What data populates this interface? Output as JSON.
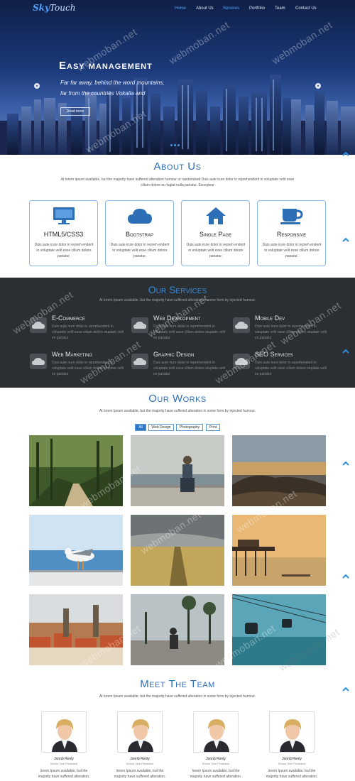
{
  "brand": {
    "part1": "Sky",
    "part2": "Touch"
  },
  "nav": [
    {
      "label": "Home",
      "active": true
    },
    {
      "label": "About Us",
      "active": false
    },
    {
      "label": "Services",
      "active": true
    },
    {
      "label": "Portfolio",
      "active": false
    },
    {
      "label": "Team",
      "active": false
    },
    {
      "label": "Contact Us",
      "active": false
    }
  ],
  "hero": {
    "title": "Easy management",
    "sub_line1": "Far far away, behind the word mountains,",
    "sub_line2": "far from the countries Vokalia and",
    "button": "Read more"
  },
  "about": {
    "title": "About Us",
    "text_line1": "At lorem ipsum available, but the majority have suffered alteration humour or randomised Duis aute irure dolor in reprehenderit in voluptate velit esse",
    "text_line2": "cillum dolore eu fugiat nulla pariatur. Excepteur",
    "cards": [
      {
        "icon": "monitor-icon",
        "name": "HTML5/CSS3",
        "desc": "Duis aute irure dolor in repreh enderit in voluptate velit esse cillum dolore pariatur."
      },
      {
        "icon": "cloud-icon",
        "name": "Bootstrap",
        "desc": "Duis aute irure dolor in repreh enderit in voluptate velit esse cillum dolore pariatur."
      },
      {
        "icon": "home-icon",
        "name": "Single Page",
        "desc": "Duis aute irure dolor in repreh enderit in voluptate velit esse cillum dolore pariatur."
      },
      {
        "icon": "coffee-cup-icon",
        "name": "Responsive",
        "desc": "Duis aute irure dolor in repreh enderit in voluptate velit esse cillum dolore pariatur."
      }
    ]
  },
  "services": {
    "title": "Our Services",
    "text": "At lorem Ipsum available, but the majority have suffered alteration in some form by injected humour.",
    "items": [
      {
        "name": "E-Commerce",
        "desc": "Duis aute irure dolor in reprehenderit in voluptate velit esse cillum dolore stuplate velit es pariatur"
      },
      {
        "name": "Web Development",
        "desc": "Duis aute irure dolor in reprehenderit in voluptate velit esse cillum dolore stuplate velit es pariatur"
      },
      {
        "name": "Mobile Dev",
        "desc": "Duis aute irure dolor in reprehenderit in voluptate velit esse cillum dolore stuplate velit es pariatur"
      },
      {
        "name": "Web Marketing",
        "desc": "Duis aute irure dolor in reprehenderit in voluptate velit esse cillum dolore stuplate velit es pariatur"
      },
      {
        "name": "Graphic Design",
        "desc": "Duis aute irure dolor in reprehenderit in voluptate velit esse cillum dolore stuplate velit es pariatur"
      },
      {
        "name": "SEO Services",
        "desc": "Duis aute irure dolor in reprehenderit in voluptate velit esse cillum dolore stuplate velit es pariatur"
      }
    ]
  },
  "works": {
    "title": "Our Works",
    "text": "At lorem Ipsum available, but the majority have suffered alteration in some form by injected humour.",
    "filters": [
      {
        "label": "All",
        "active": true
      },
      {
        "label": "Web Design",
        "active": false
      },
      {
        "label": "Photography",
        "active": false
      },
      {
        "label": "Print",
        "active": false
      }
    ]
  },
  "team": {
    "title": "Meet The Team",
    "text": "At lorem Ipsum available, but the majority have suffered alteration in some form by injected humour.",
    "members": [
      {
        "name": "Jonnb Renly",
        "role": "Senior Vice President",
        "desc_line1": "lorem Ipsum available, but the",
        "desc_line2": "majority have suffered alteration."
      },
      {
        "name": "Jonnb Renly",
        "role": "Senior Vice President",
        "desc_line1": "lorem Ipsum available, but the",
        "desc_line2": "majority have suffered alteration."
      },
      {
        "name": "Jonnb Renly",
        "role": "Senior Vice President",
        "desc_line1": "lorem Ipsum available, but the",
        "desc_line2": "majority have suffered alteration."
      },
      {
        "name": "Jonnb Renly",
        "role": "Senior Vice President",
        "desc_line1": "lorem Ipsum available, but the",
        "desc_line2": "majority have suffered alteration."
      }
    ]
  },
  "watermark": "webmoban.net",
  "colors": {
    "accent": "#2d6fb7",
    "dark_section": "#2a2f33",
    "nav_active": "#4fa3ff"
  }
}
